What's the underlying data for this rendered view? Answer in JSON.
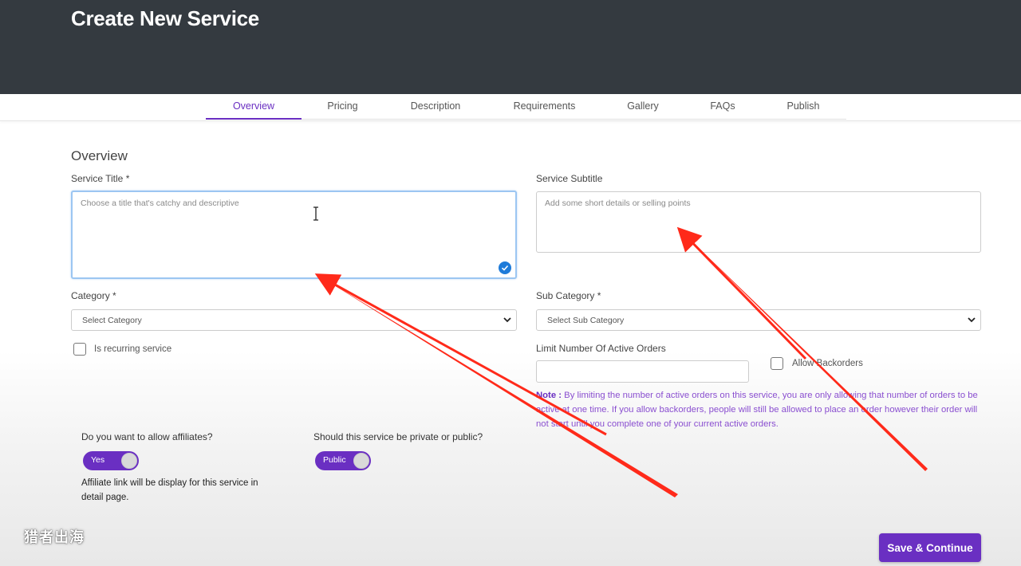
{
  "page": {
    "title": "Create New Service"
  },
  "tabs": [
    {
      "label": "Overview",
      "active": true
    },
    {
      "label": "Pricing",
      "active": false
    },
    {
      "label": "Description",
      "active": false
    },
    {
      "label": "Requirements",
      "active": false
    },
    {
      "label": "Gallery",
      "active": false
    },
    {
      "label": "FAQs",
      "active": false
    },
    {
      "label": "Publish",
      "active": false
    }
  ],
  "overview": {
    "heading": "Overview",
    "service_title": {
      "label": "Service Title *",
      "placeholder": "Choose a title that's catchy and descriptive",
      "value": ""
    },
    "service_subtitle": {
      "label": "Service Subtitle",
      "placeholder": "Add some short details or selling points",
      "value": ""
    },
    "category": {
      "label": "Category *",
      "selected": "Select Category"
    },
    "sub_category": {
      "label": "Sub Category *",
      "selected": "Select Sub Category"
    },
    "recurring": {
      "label": "Is recurring service",
      "checked": false
    },
    "limit_orders": {
      "label": "Limit Number Of Active Orders",
      "value": ""
    },
    "backorders": {
      "label": "Allow Backorders",
      "checked": false
    },
    "note": {
      "prefix": "Note :",
      "text": " By limiting the number of active orders on this service, you are only allowing that number of orders to be active at one time. If you allow backorders, people will still be allowed to place an order however their order will not start until you complete one of your current active orders."
    },
    "affiliates": {
      "question": "Do you want to allow affiliates?",
      "toggle_label": "Yes",
      "on": true,
      "note": "Affiliate link will be display for this service in detail page."
    },
    "visibility": {
      "question": "Should this service be private or public?",
      "toggle_label": "Public",
      "on": true
    }
  },
  "actions": {
    "save_label": "Save & Continue"
  },
  "watermark": "猎者出海",
  "colors": {
    "header_bg": "#343a40",
    "accent": "#6a2fc2",
    "annotation_arrow": "#ff2a1a"
  }
}
